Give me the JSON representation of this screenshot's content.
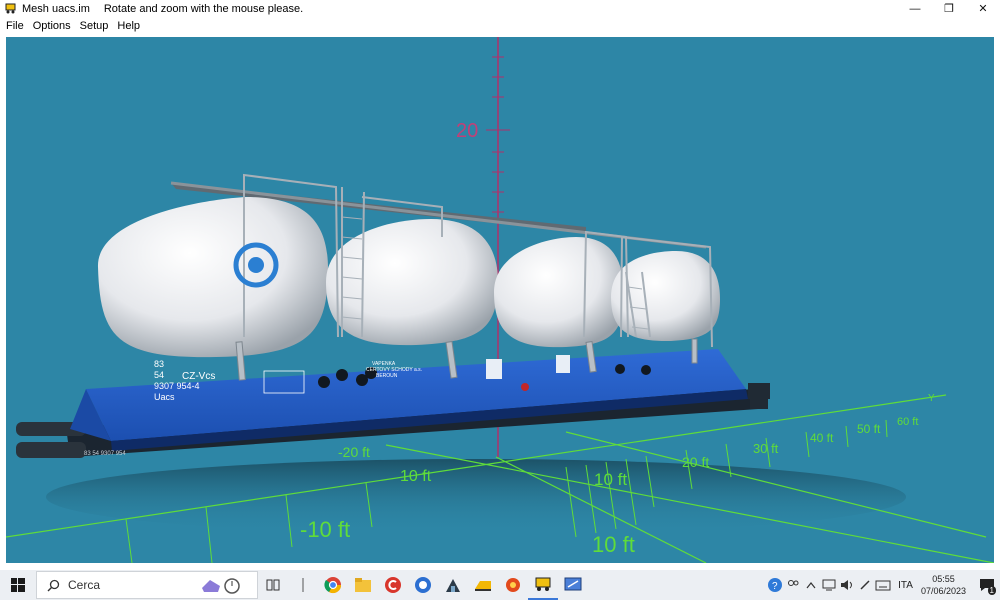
{
  "window": {
    "title": "Mesh uacs.im",
    "message": "Rotate and zoom with the mouse please.",
    "controls": {
      "minimize": "—",
      "restore": "❐",
      "close": "✕"
    }
  },
  "menu": {
    "items": [
      "File",
      "Options",
      "Setup",
      "Help"
    ]
  },
  "scene": {
    "background_color": "#2d86a6",
    "vertical_axis_label": "20",
    "axis_y_letter": "Y",
    "tick_labels": [
      "-20 ft",
      "10 ft",
      "20 ft",
      "30 ft",
      "40 ft",
      "50 ft",
      "60 ft",
      "-10 ft",
      "10 ft",
      "10 ft"
    ],
    "wagon_text": {
      "left_block": "83\n54\n9307 954-4\nUacs",
      "cz": "CZ-Vcs",
      "owner": "VAPENKA\nCERTOVY SCHODY a.s.\nBEROUN",
      "bottom": "83 54 9307 954"
    }
  },
  "taskbar": {
    "search_placeholder": "Cerca",
    "language": "ITA",
    "time": "05:55",
    "date": "07/06/2023",
    "notification_count": "1"
  }
}
